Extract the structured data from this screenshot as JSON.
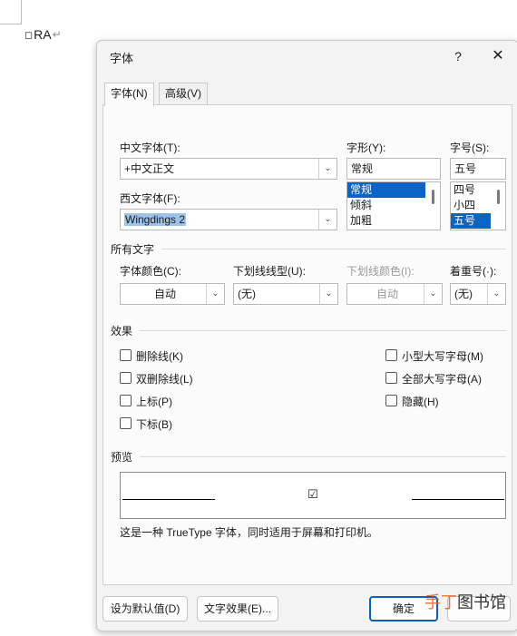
{
  "document": {
    "text": "RA",
    "glyph": "◻",
    "para_mark": "↵"
  },
  "dialog": {
    "title": "字体",
    "help_label": "?",
    "close_label": "✕",
    "tabs": [
      {
        "label": "字体(N)",
        "active": true
      },
      {
        "label": "高级(V)",
        "active": false
      }
    ],
    "chinese_font": {
      "label": "中文字体(T):",
      "value": "+中文正文"
    },
    "western_font": {
      "label": "西文字体(F):",
      "value": "Wingdings 2"
    },
    "style": {
      "label": "字形(Y):",
      "value": "常规",
      "options": [
        "常规",
        "倾斜",
        "加粗"
      ],
      "selected": "常规"
    },
    "size": {
      "label": "字号(S):",
      "value": "五号",
      "options": [
        "四号",
        "小四",
        "五号"
      ],
      "selected": "五号"
    },
    "all_text": {
      "section": "所有文字",
      "font_color": {
        "label": "字体颜色(C):",
        "value": "自动"
      },
      "underline_style": {
        "label": "下划线线型(U):",
        "value": "(无)"
      },
      "underline_color": {
        "label": "下划线颜色(I):",
        "value": "自动"
      },
      "emphasis": {
        "label": "着重号(·):",
        "value": "(无)"
      }
    },
    "effects": {
      "section": "效果",
      "strikethrough": "删除线(K)",
      "double_strikethrough": "双删除线(L)",
      "superscript": "上标(P)",
      "subscript": "下标(B)",
      "small_caps": "小型大写字母(M)",
      "all_caps": "全部大写字母(A)",
      "hidden": "隐藏(H)"
    },
    "preview": {
      "section": "预览",
      "glyph": "☑",
      "note": "这是一种 TrueType 字体，同时适用于屏幕和打印机。"
    },
    "buttons": {
      "set_default": "设为默认值(D)",
      "text_effects": "文字效果(E)...",
      "ok": "确定"
    }
  },
  "watermark": {
    "part1": "手丁",
    "part2": "图书馆"
  }
}
